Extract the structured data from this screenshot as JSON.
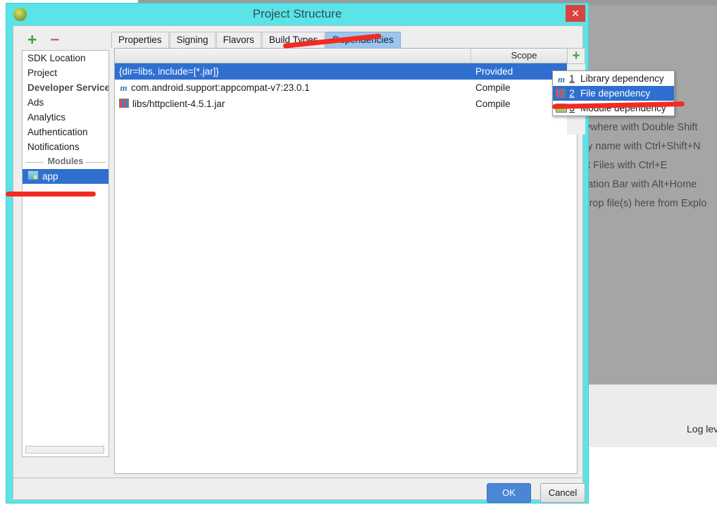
{
  "window": {
    "title": "Project Structure",
    "close_label": "✕",
    "app_icon": "android-studio-icon"
  },
  "background": {
    "hints": [
      "rywhere with Double Shift",
      " by name with Ctrl+Shift+N",
      "nt Files with Ctrl+E",
      "gation Bar with Alt+Home",
      "Drop file(s) here from Explo"
    ],
    "log_level": "Log lev"
  },
  "sidebar": {
    "toolbar": {
      "add": "+",
      "remove": "−"
    },
    "items": [
      {
        "label": "SDK Location",
        "type": "item",
        "selected": false
      },
      {
        "label": "Project",
        "type": "item",
        "selected": false
      },
      {
        "label": "Developer Services",
        "type": "header",
        "selected": false
      },
      {
        "label": "Ads",
        "type": "item",
        "selected": false
      },
      {
        "label": "Analytics",
        "type": "item",
        "selected": false
      },
      {
        "label": "Authentication",
        "type": "item",
        "selected": false
      },
      {
        "label": "Notifications",
        "type": "item",
        "selected": false
      },
      {
        "label": "Modules",
        "type": "separator",
        "selected": false
      },
      {
        "label": "app",
        "type": "module",
        "selected": true
      }
    ]
  },
  "tabs": [
    {
      "label": "Properties",
      "active": false
    },
    {
      "label": "Signing",
      "active": false
    },
    {
      "label": "Flavors",
      "active": false
    },
    {
      "label": "Build Types",
      "active": false
    },
    {
      "label": "Dependencies",
      "active": true
    }
  ],
  "dependencies": {
    "columns": {
      "name": "",
      "scope": "Scope"
    },
    "add_button": "+",
    "rows": [
      {
        "name": "{dir=libs, include=[*.jar]}",
        "scope": "Provided",
        "icon": "none",
        "selected": true
      },
      {
        "name": "com.android.support:appcompat-v7:23.0.1",
        "scope": "Compile",
        "icon": "maven-icon",
        "selected": false
      },
      {
        "name": "libs/httpclient-4.5.1.jar",
        "scope": "Compile",
        "icon": "jar-icon",
        "selected": false
      }
    ]
  },
  "popup_menu": {
    "items": [
      {
        "num": "1",
        "label": "Library dependency",
        "icon": "maven-icon",
        "selected": false
      },
      {
        "num": "2",
        "label": "File dependency",
        "icon": "jar-icon",
        "selected": true
      },
      {
        "num": "3",
        "label": "Module dependency",
        "icon": "module-icon",
        "selected": false
      }
    ]
  },
  "footer": {
    "ok_label": "OK",
    "cancel_label": "Cancel"
  },
  "colors": {
    "title_bar": "#5ae4e8",
    "selection": "#2f6fd0",
    "accent_tab": "#9cc6ee",
    "marker_red": "#f32a23",
    "ok_blue": "#4a86d4",
    "close_red": "#d9433f"
  }
}
